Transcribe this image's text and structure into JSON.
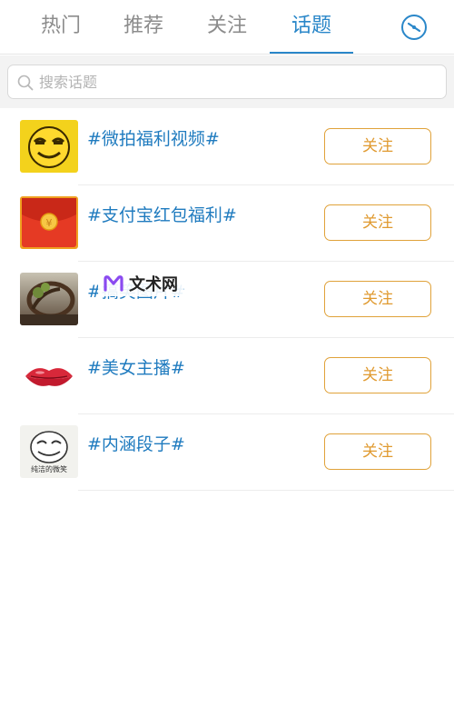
{
  "tabs": [
    {
      "label": "热门",
      "active": false
    },
    {
      "label": "推荐",
      "active": false
    },
    {
      "label": "关注",
      "active": false
    },
    {
      "label": "话题",
      "active": true
    }
  ],
  "header": {
    "compass_icon": "compass-icon"
  },
  "search": {
    "placeholder": "搜索话题",
    "value": ""
  },
  "topics": [
    {
      "title": "#微拍福利视频#",
      "follow_label": "关注",
      "thumb": "yellow-smiley-face"
    },
    {
      "title": "#支付宝红包福利#",
      "follow_label": "关注",
      "thumb": "red-envelope"
    },
    {
      "title": "#搞笑图片#",
      "follow_label": "关注",
      "thumb": "tree-art-photo"
    },
    {
      "title": "#美女主播#",
      "follow_label": "关注",
      "thumb": "red-lips"
    },
    {
      "title": "#内涵段子#",
      "follow_label": "关注",
      "thumb": "cartoon-face-sketch",
      "thumb_caption": "纯洁的微笑"
    }
  ],
  "watermark": {
    "text": "文术网"
  },
  "colors": {
    "accent": "#2a87c9",
    "topic_text": "#1f7bbf",
    "follow_border": "#e0a23a"
  }
}
